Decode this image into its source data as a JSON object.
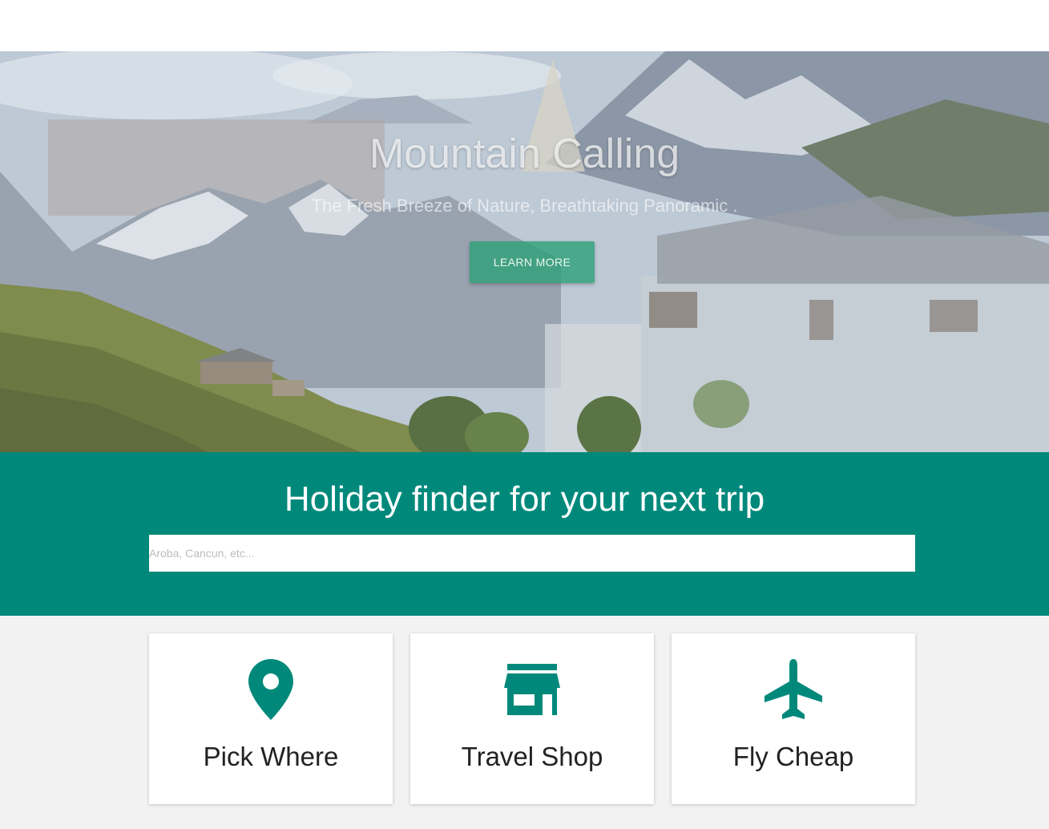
{
  "hero": {
    "title": "Mountain Calling",
    "subtitle": "The Fresh Breeze of Nature, Breathtaking Panoramic .",
    "button_label": "LEARN MORE"
  },
  "finder": {
    "title": "Holiday finder for your next trip",
    "placeholder": "Aroba, Cancun, etc..."
  },
  "cards": [
    {
      "label": "Pick Where",
      "icon": "map-pin-icon"
    },
    {
      "label": "Travel Shop",
      "icon": "store-icon"
    },
    {
      "label": "Fly Cheap",
      "icon": "airplane-icon"
    }
  ],
  "colors": {
    "primary": "#00897b",
    "button": "#2da078"
  }
}
